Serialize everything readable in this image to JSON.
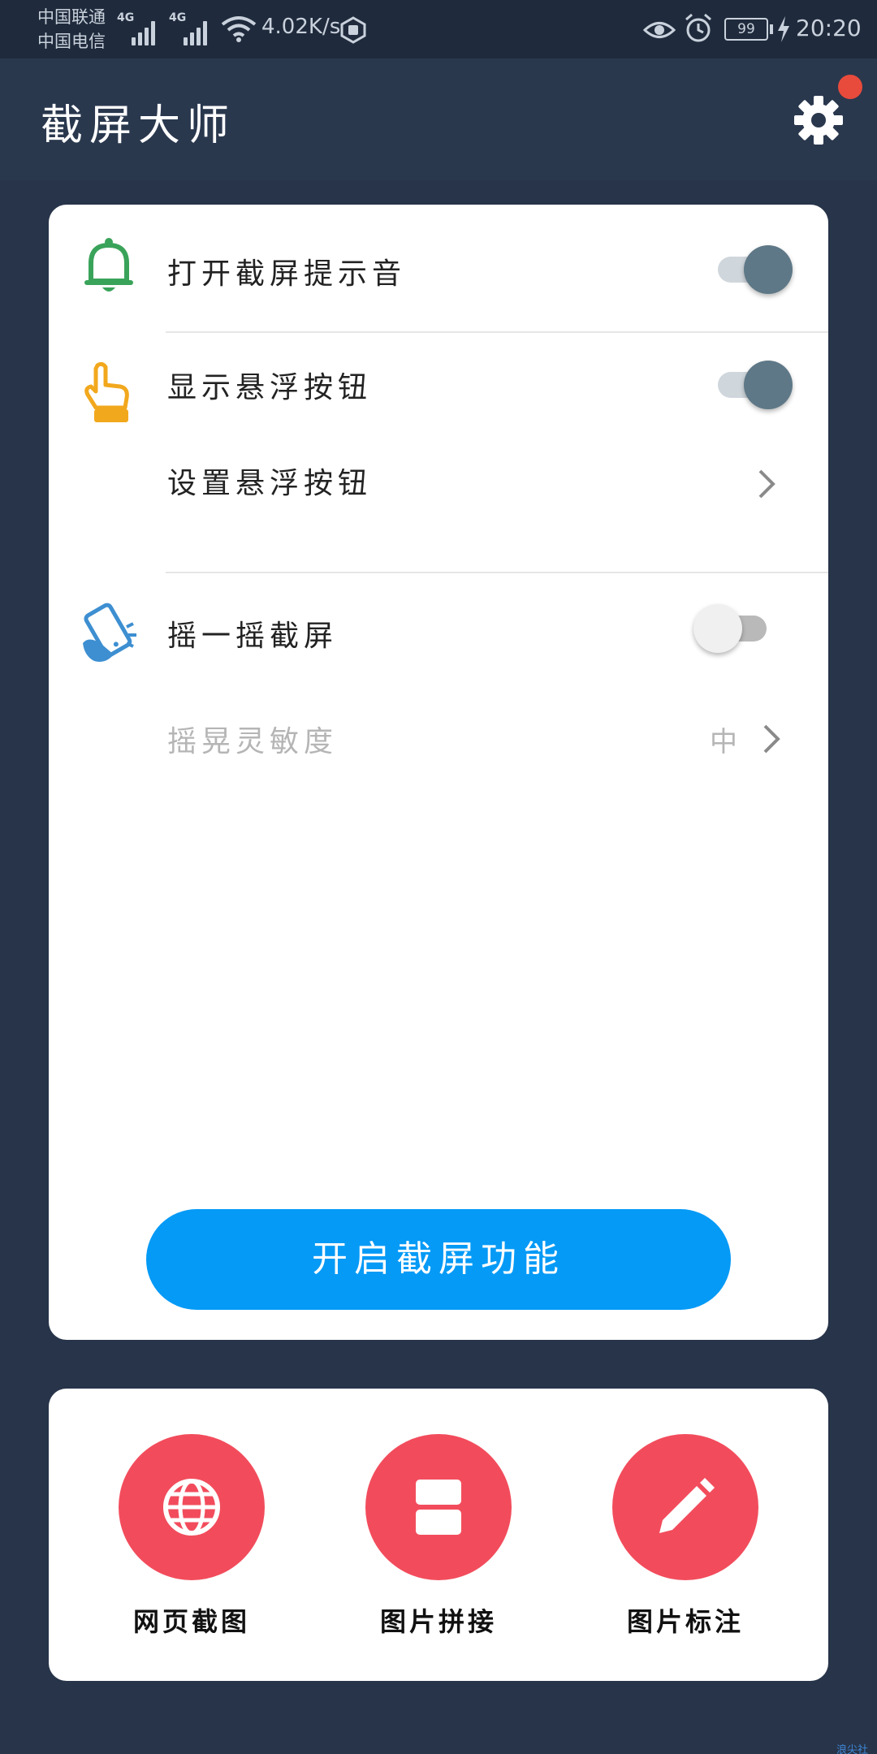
{
  "status_bar": {
    "carrier_1": "中国联通",
    "carrier_2": "中国电信",
    "sim1_type": "4G",
    "sim2_type": "4G",
    "net_speed": "4.02K/s",
    "battery": "99",
    "time": "20:20"
  },
  "app_bar": {
    "title": "截屏大师",
    "settings_icon": "gear-icon",
    "has_notification_dot": true
  },
  "settings": {
    "sound": {
      "label": "打开截屏提示音",
      "enabled": true,
      "icon": "bell-icon",
      "icon_color": "#3aa35a"
    },
    "float_button": {
      "label": "显示悬浮按钮",
      "enabled": true,
      "icon": "pointing-hand-icon",
      "icon_color": "#f2a81d"
    },
    "float_settings": {
      "label": "设置悬浮按钮"
    },
    "shake": {
      "label": "摇一摇截屏",
      "enabled": false,
      "icon": "shake-phone-icon",
      "icon_color": "#3d8fd1"
    },
    "shake_sensitivity": {
      "label": "摇晃灵敏度",
      "value": "中"
    }
  },
  "start_button": {
    "label": "开启截屏功能"
  },
  "tools": [
    {
      "label": "网页截图",
      "icon": "globe-icon"
    },
    {
      "label": "图片拼接",
      "icon": "stitch-icon"
    },
    {
      "label": "图片标注",
      "icon": "pencil-icon"
    }
  ],
  "colors": {
    "background": "#273449",
    "accent_blue": "#059af6",
    "tool_red": "#f24c5c",
    "toggle_on": "#5e7887"
  },
  "watermark": "浪尖社区"
}
